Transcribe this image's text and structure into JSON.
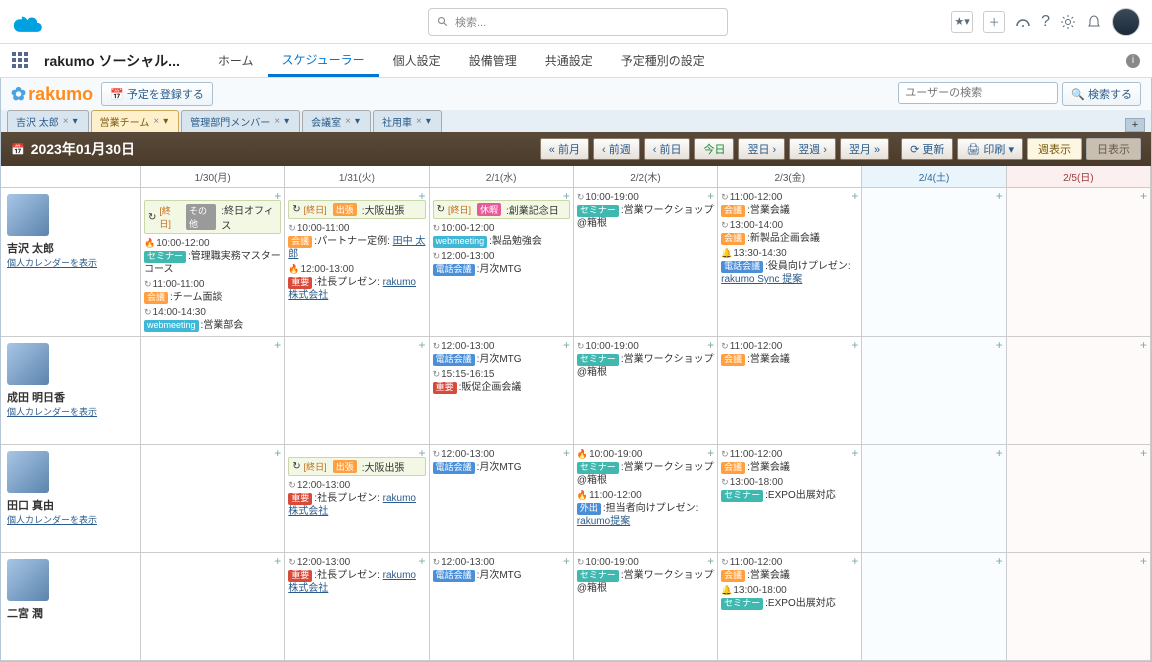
{
  "sf": {
    "search_placeholder": "検索...",
    "app_name": "rakumo ソーシャル...",
    "tabs": [
      "ホーム",
      "スケジューラー",
      "個人設定",
      "設備管理",
      "共通設定",
      "予定種別の設定"
    ],
    "active_tab": 1
  },
  "rk": {
    "register": "予定を登録する",
    "cal_icon": "📅",
    "search_placeholder": "ユーザーの検索",
    "search_btn": "検索する",
    "search_icon": "🔍",
    "tabs": [
      {
        "label": "吉沢 太郎"
      },
      {
        "label": "営業チーム"
      },
      {
        "label": "管理部門メンバー"
      },
      {
        "label": "会議室"
      },
      {
        "label": "社用車"
      }
    ],
    "active_tab": 1
  },
  "nav": {
    "date": "2023年01月30日",
    "prev_month": "前月",
    "prev_week": "前週",
    "prev_day": "前日",
    "today": "今日",
    "next_day": "翌日",
    "next_week": "翌週",
    "next_month": "翌月",
    "update": "更新",
    "print": "印刷",
    "icons": {
      "update": "⟳",
      "print": "🖨"
    },
    "week_view": "週表示",
    "day_view": "日表示"
  },
  "days": [
    {
      "label": "1/30(月)",
      "cls": ""
    },
    {
      "label": "1/31(火)",
      "cls": ""
    },
    {
      "label": "2/1(水)",
      "cls": ""
    },
    {
      "label": "2/2(木)",
      "cls": ""
    },
    {
      "label": "2/3(金)",
      "cls": ""
    },
    {
      "label": "2/4(土)",
      "cls": "sat"
    },
    {
      "label": "2/5(日)",
      "cls": "sun"
    }
  ],
  "users": [
    {
      "name": "吉沢 太郎",
      "link": "個人カレンダーを表示"
    },
    {
      "name": "成田 明日香",
      "link": "個人カレンダーを表示"
    },
    {
      "name": "田口 真由",
      "link": "個人カレンダーを表示"
    },
    {
      "name": "二宮 潤",
      "link": ""
    }
  ],
  "strings": {
    "allday": "[終日]",
    "evts": {
      "officeAllDay": ":終日オフィス",
      "seminarMaster": ":管理職実務マスターコース",
      "teamMtg": ":チーム面談",
      "salesDept": ":営業部会",
      "osaka": ":大阪出張",
      "partner": ":パートナー定例:",
      "partnerLink": "田中 太郎",
      "president": ":社長プレゼン:",
      "presidentLink": "rakumo株式会社",
      "anniversary": ":創業記念日",
      "study": ":製品勉強会",
      "monthly": ":月次MTG",
      "sales": ":販促企画会議",
      "workshop": ":営業ワークショップ @箱根",
      "bizMtg": ":営業会議",
      "newprod": ":新製品企画会議",
      "execPresent": ":役員向けプレゼン:",
      "execLink": "rakumo Sync 提案",
      "expo": ":EXPO出展対応",
      "tantou": ":担当者向けプレゼン:",
      "tantouLink": "rakumo提案"
    },
    "tags": {
      "other": "その他",
      "seminar": "セミナー",
      "meeting": "会議",
      "web": "webmeeting",
      "trip": "出張",
      "important": "重要",
      "holiday": "休暇",
      "phone": "電話会議",
      "out": "外出"
    },
    "times": {
      "t10_12": "10:00-12:00",
      "t11_11": "11:00-11:00",
      "t14_1430": "14:00-14:30",
      "t10_11": "10:00-11:00",
      "t12_13": "12:00-13:00",
      "t1515_1615": "15:15-16:15",
      "t10_19": "10:00-19:00",
      "t11_12": "11:00-12:00",
      "t13_14": "13:00-14:00",
      "t1330_1430": "13:30-14:30",
      "t13_18": "13:00-18:00"
    }
  }
}
